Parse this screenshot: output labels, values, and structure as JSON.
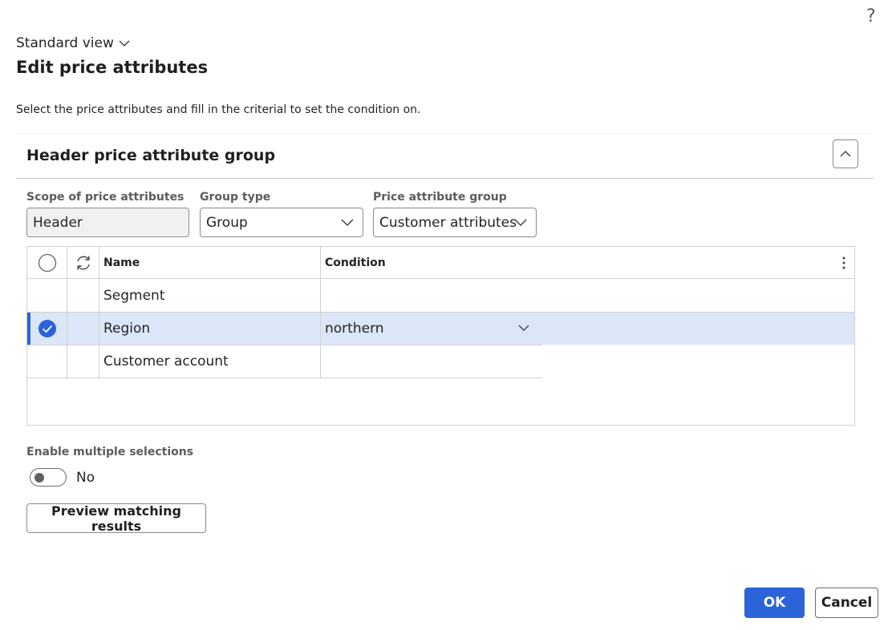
{
  "help": {
    "label": "?"
  },
  "view": {
    "label": "Standard view"
  },
  "page": {
    "title": "Edit price attributes",
    "instructions": "Select the price attributes and fill in the criterial to set the condition on."
  },
  "section": {
    "title": "Header price attribute group"
  },
  "fields": {
    "scope": {
      "label": "Scope of price attributes",
      "value": "Header"
    },
    "group_type": {
      "label": "Group type",
      "value": "Group"
    },
    "price_attribute_group": {
      "label": "Price attribute group",
      "value": "Customer attributes"
    }
  },
  "grid": {
    "columns": {
      "name": "Name",
      "condition": "Condition"
    },
    "rows": [
      {
        "name": "Segment",
        "condition": "",
        "selected": false
      },
      {
        "name": "Region",
        "condition": "northern",
        "selected": true
      },
      {
        "name": "Customer account",
        "condition": "",
        "selected": false
      }
    ]
  },
  "multi_select": {
    "label": "Enable multiple selections",
    "value": "No"
  },
  "buttons": {
    "preview": "Preview matching results",
    "ok": "OK",
    "cancel": "Cancel"
  },
  "colors": {
    "accent": "#2b63d9",
    "selected_row": "#dce6f9"
  },
  "icons": [
    "help-icon",
    "chevron-down-icon",
    "chevron-up-icon",
    "refresh-icon",
    "more-vertical-icon",
    "checkmark-circle-icon",
    "radio-circle-icon"
  ]
}
